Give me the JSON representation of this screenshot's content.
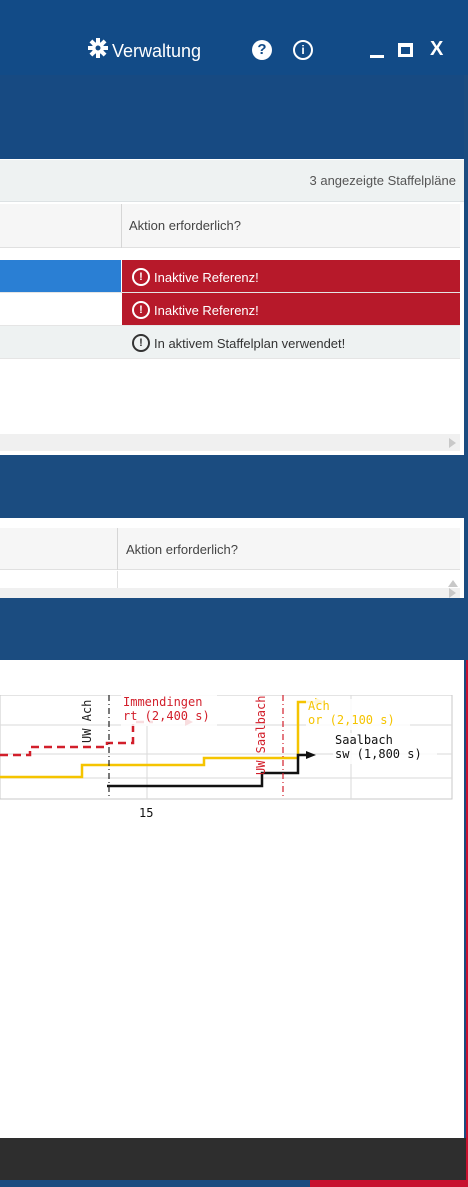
{
  "titlebar": {
    "admin_label": "Verwaltung",
    "help_glyph": "?",
    "info_glyph": "i",
    "close_glyph": "X",
    "background": "#124b87"
  },
  "staffel_panel": {
    "count_text": "3 angezeigte Staffelpläne",
    "column_header": "Aktion erforderlich?",
    "rows": [
      {
        "action": "Inaktive Referenz!",
        "status": "error",
        "selected": true
      },
      {
        "action": "Inaktive Referenz!",
        "status": "error",
        "selected": false
      },
      {
        "action": "In aktivem Staffelplan verwendet!",
        "status": "info",
        "selected": false
      }
    ]
  },
  "second_panel": {
    "column_header": "Aktion erforderlich?"
  },
  "colors": {
    "header_blue": "#1b4c80",
    "selection_blue": "#2a7fd4",
    "error_red": "#b7192a",
    "series_yellow": "#f5c400",
    "series_red": "#d21f2b",
    "series_black": "#111111"
  },
  "chart_data": {
    "type": "line",
    "x_tick_labels": [
      "15"
    ],
    "vertical_markers": [
      {
        "label": "UW Ach",
        "color": "#222222"
      },
      {
        "label": "UW Saalbach",
        "color": "#d21f2b"
      }
    ],
    "annotations": [
      {
        "text_line1": "Immendingen",
        "text_line2": "rt (2,400 s)",
        "color": "#d21f2b"
      },
      {
        "text_line1": "Ach",
        "text_line2": "or (2,100 s)",
        "color": "#f5c400"
      },
      {
        "text_line1": "Saalbach",
        "text_line2": "sw (1,800 s)",
        "color": "#111111"
      }
    ],
    "series": [
      {
        "color": "#d21f2b",
        "style": "dashed"
      },
      {
        "color": "#f5c400",
        "style": "solid"
      },
      {
        "color": "#111111",
        "style": "solid"
      }
    ],
    "grid": true
  }
}
